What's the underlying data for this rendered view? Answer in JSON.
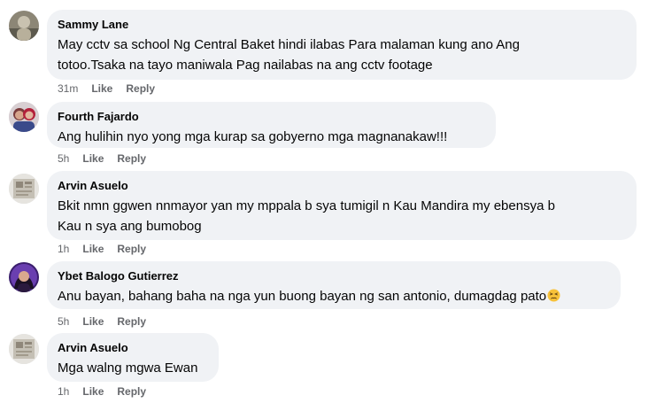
{
  "comments": [
    {
      "author": "Sammy Lane",
      "lines": [
        "May cctv sa school Ng Central Baket hindi ilabas Para malaman kung ano Ang",
        "totoo.Tsaka na tayo maniwala Pag nailabas na ang cctv footage"
      ],
      "time": "31m",
      "like_label": "Like",
      "reply_label": "Reply"
    },
    {
      "author": "Fourth Fajardo",
      "lines": [
        "Ang hulihin nyo yong mga kurap sa gobyerno mga magnanakaw!!!"
      ],
      "time": "5h",
      "like_label": "Like",
      "reply_label": "Reply"
    },
    {
      "author": "Arvin Asuelo",
      "lines": [
        "Bkit nmn ggwen nnmayor yan my mppala b sya tumigil n Kau Mandira my ebensya b",
        "Kau n sya ang bumobog"
      ],
      "time": "1h",
      "like_label": "Like",
      "reply_label": "Reply"
    },
    {
      "author": "Ybet Balogo Gutierrez",
      "lines": [
        "Anu bayan, bahang baha na nga yun buong bayan ng san antonio, dumagdag pato"
      ],
      "emoji": "persevering-face-emoji",
      "time": "5h",
      "like_label": "Like",
      "reply_label": "Reply"
    },
    {
      "author": "Arvin Asuelo",
      "lines": [
        "Mga walng mgwa Ewan"
      ],
      "time": "1h",
      "like_label": "Like",
      "reply_label": "Reply"
    }
  ],
  "colors": {
    "bubble": "#f0f2f5",
    "text": "#050505",
    "meta": "#65676b"
  }
}
